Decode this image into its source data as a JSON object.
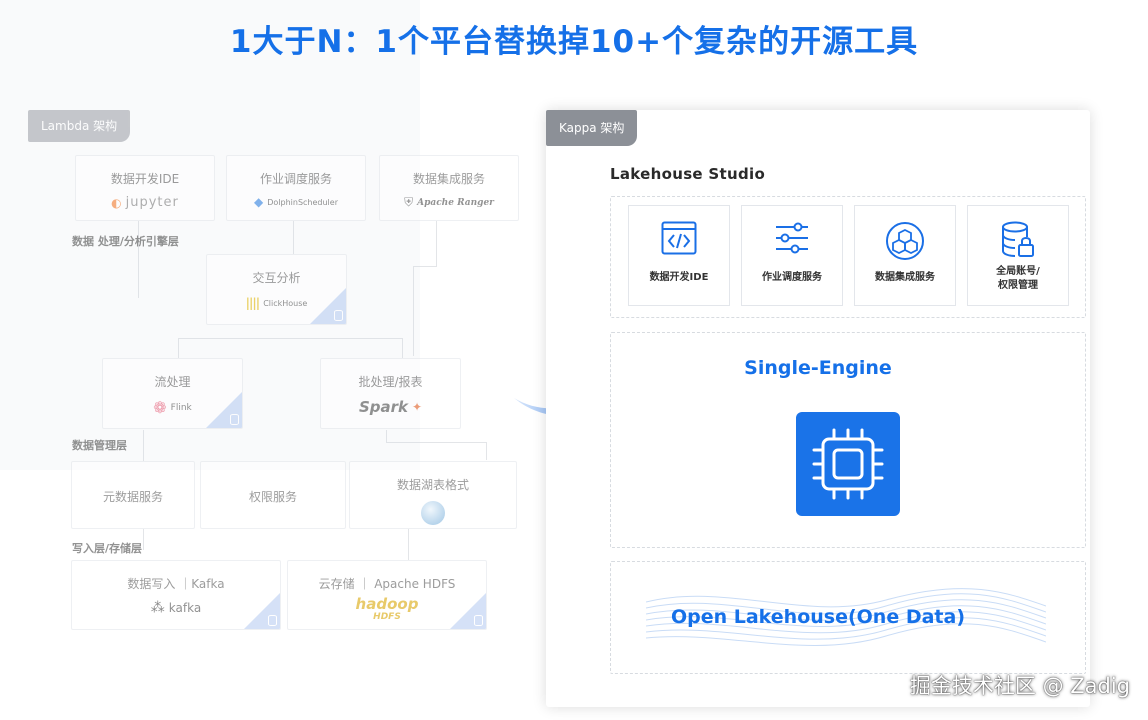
{
  "title": "1大于N：1个平台替换掉10+个复杂的开源工具",
  "lambda": {
    "tag": "Lambda 架构",
    "dev_ide": {
      "name": "数据开发IDE",
      "logo": "jupyter"
    },
    "scheduler": {
      "name": "作业调度服务",
      "logo": "DolphinScheduler"
    },
    "integration": {
      "name": "数据集成服务",
      "logo": "Apache Ranger"
    },
    "layer_compute": "数据 处理/分析引擎层",
    "interactive": {
      "name": "交互分析",
      "logo": "ClickHouse"
    },
    "stream": {
      "name": "流处理",
      "logo": "Flink"
    },
    "batch": {
      "name": "批处理/报表",
      "logo": "Spark"
    },
    "layer_manage": "数据管理层",
    "metadata": {
      "name": "元数据服务"
    },
    "permission": {
      "name": "权限服务"
    },
    "lake_format": {
      "name": "数据湖表格式"
    },
    "layer_storage": "写入层/存储层",
    "ingest": {
      "name": "数据写入 ｜Kafka",
      "logo": "kafka"
    },
    "cloud_storage": {
      "name": "云存储 ｜ Apache HDFS",
      "logo": "hadoop",
      "logo_sub": "HDFS"
    }
  },
  "kappa": {
    "tag": "Kappa 架构",
    "studio": "Lakehouse  Studio",
    "tools": [
      {
        "label": "数据开发IDE",
        "icon": "code-window-icon"
      },
      {
        "label": "作业调度服务",
        "icon": "sliders-icon"
      },
      {
        "label": "数据集成服务",
        "icon": "cubes-icon"
      },
      {
        "label": "全局账号/",
        "label2": "权限管理",
        "icon": "database-lock-icon"
      }
    ],
    "engine": "Single-Engine",
    "lakehouse": "Open Lakehouse(One Data)"
  },
  "watermark": "掘金技术社区 @ Zadig",
  "colors": {
    "accent": "#1570e8",
    "chip": "#1a73e8",
    "tag": "#8c9097"
  }
}
